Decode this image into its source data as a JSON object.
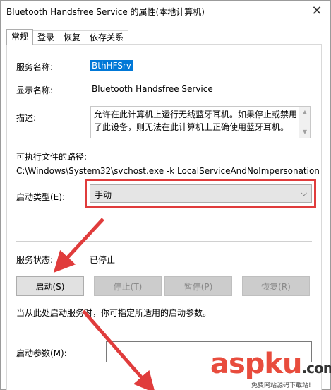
{
  "window": {
    "title": "Bluetooth Handsfree Service 的属性(本地计算机)",
    "close_glyph": "✕"
  },
  "tabs": [
    {
      "label": "常规",
      "active": true
    },
    {
      "label": "登录",
      "active": false
    },
    {
      "label": "恢复",
      "active": false
    },
    {
      "label": "依存关系",
      "active": false
    }
  ],
  "general": {
    "service_name_label": "服务名称:",
    "service_name_value": "BthHFSrv",
    "display_name_label": "显示名称:",
    "display_name_value": "Bluetooth Handsfree Service",
    "description_label": "描述:",
    "description_value": "允许在此计算机上运行无线蓝牙耳机。如果停止或禁用了此设备，则无法在此计算机上正确使用蓝牙耳机。",
    "exe_path_label": "可执行文件的路径:",
    "exe_path_value": "C:\\Windows\\System32\\svchost.exe -k LocalServiceAndNoImpersonation",
    "startup_type_label": "启动类型(E):",
    "startup_type_value": "手动",
    "status_label": "服务状态:",
    "status_value": "已停止",
    "buttons": {
      "start": "启动(S)",
      "stop": "停止(T)",
      "pause": "暂停(P)",
      "resume": "恢复(R)"
    },
    "hint": "当从此处启动服务时，你可指定所适用的启动参数。",
    "params_label": "启动参数(M):",
    "params_value": ""
  },
  "watermark": {
    "brand": "aspku",
    "tld": ".com",
    "tagline": "免费网站源码下载站!"
  },
  "colors": {
    "highlight": "#0078d7",
    "annotation_red": "#e03c3c"
  }
}
